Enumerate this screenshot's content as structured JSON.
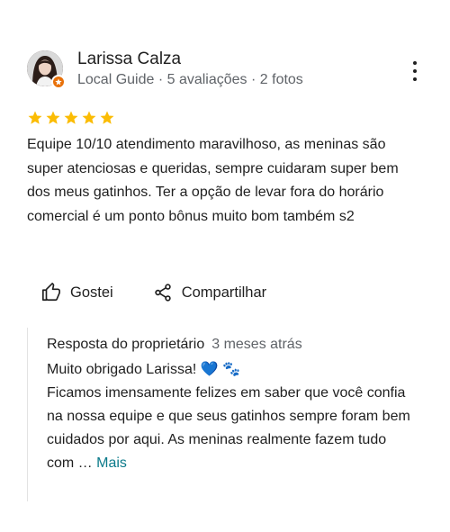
{
  "review": {
    "author_name": "Larissa Calza",
    "author_meta": "Local Guide · 5 avaliações · 2 fotos",
    "rating": 5,
    "text": "Equipe 10/10 atendimento maravilhoso, as meninas são super atenciosas e queridas, sempre cuidaram super bem dos meus gatinhos. Ter a opção de levar fora do horário comercial é um ponto bônus muito bom também s2",
    "star_color": "#fbbc04"
  },
  "actions": {
    "like_label": "Gostei",
    "share_label": "Compartilhar"
  },
  "owner_response": {
    "title": "Resposta do proprietário",
    "time": "3 meses atrás",
    "line1": "Muito obrigado Larissa! 💙 🐾",
    "body": "Ficamos imensamente felizes em saber que você confia na nossa equipe e que seus gatinhos sempre foram bem cuidados por aqui. As meninas realmente fazem tudo com …",
    "more_label": "Mais"
  },
  "icons": {
    "more": "more-vert-icon",
    "like": "thumb-up-icon",
    "share": "share-icon",
    "badge": "local-guide-badge-icon"
  }
}
